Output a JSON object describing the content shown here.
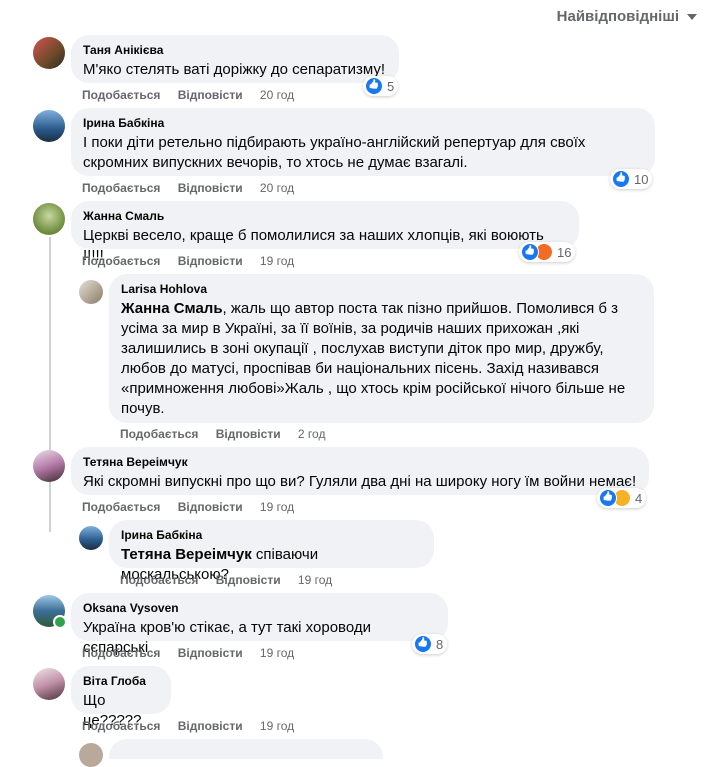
{
  "sort_label": "Найвідповідніші",
  "actions": {
    "like": "Подобається",
    "reply": "Відповісти"
  },
  "comments": [
    {
      "author": "Таня Анікієва",
      "text": "М'яко стелять ваті доріжку до сепаратизму!",
      "time": "20 год",
      "reactions": "5"
    },
    {
      "author": "Ірина Бабкіна",
      "text": "І поки діти ретельно підбирають україно-англійский репертуар для своїх скромних випускних вечорів, то хтось не думає взагалі.",
      "time": "20 год",
      "reactions": "10"
    },
    {
      "author": "Жанна Смаль",
      "text": "Церкві весело, краще б помолилися за наших хлопців, які воюють !!!!!",
      "time": "19 год",
      "reactions": "16"
    },
    {
      "author": "Larisa Hohlova",
      "mention": "Жанна Смаль",
      "text": ", жаль що автор поста так пізно прийшов. Помолився б з усіма за мир в Україні, за її воїнів, за родичів наших прихожан ,які залишились в зоні окупації , послухав виступи діток про мир, дружбу, любов до матусі, проспівав би національних пісень. Захід називався «примноження любові»Жаль , що хтось крім російської нічого більше не почув.",
      "time": "2 год"
    },
    {
      "author": "Тетяна Вереімчук",
      "text": "Які скромні випускні про що ви? Гуляли два дні на широку ногу їм войни немає!",
      "time": "19 год",
      "reactions": "4"
    },
    {
      "author": "Ірина Бабкіна",
      "mention": "Тетяна Вереімчук",
      "text": " співаючи москальською?",
      "time": "19 год"
    },
    {
      "author": "Oksana Vysoven",
      "text": "Україна кров'ю стікає, а тут такі хороводи сєпарські",
      "time": "19 год",
      "reactions": "8"
    },
    {
      "author": "Віта Глоба",
      "text": "Що це?????",
      "time": "19 год"
    }
  ]
}
